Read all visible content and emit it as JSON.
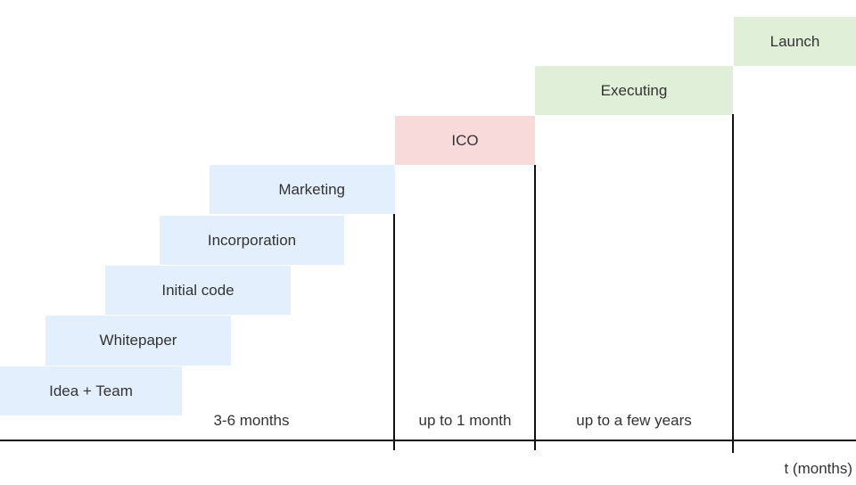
{
  "diagram": {
    "type": "staircase-timeline",
    "colors": {
      "pre_ico": "#e3effc",
      "ico": "#f9dada",
      "post_ico": "#e0efd8",
      "axis": "#111111",
      "text": "#333333"
    },
    "steps": [
      {
        "label": "Idea + Team",
        "phase": "pre_ico"
      },
      {
        "label": "Whitepaper",
        "phase": "pre_ico"
      },
      {
        "label": "Initial code",
        "phase": "pre_ico"
      },
      {
        "label": "Incorporation",
        "phase": "pre_ico"
      },
      {
        "label": "Marketing",
        "phase": "pre_ico"
      },
      {
        "label": "ICO",
        "phase": "ico"
      },
      {
        "label": "Executing",
        "phase": "post_ico"
      },
      {
        "label": "Launch",
        "phase": "post_ico"
      }
    ],
    "durations": [
      {
        "label": "3-6 months"
      },
      {
        "label": "up to 1 month"
      },
      {
        "label": "up to a few years"
      }
    ],
    "axis_label": "t (months)"
  }
}
